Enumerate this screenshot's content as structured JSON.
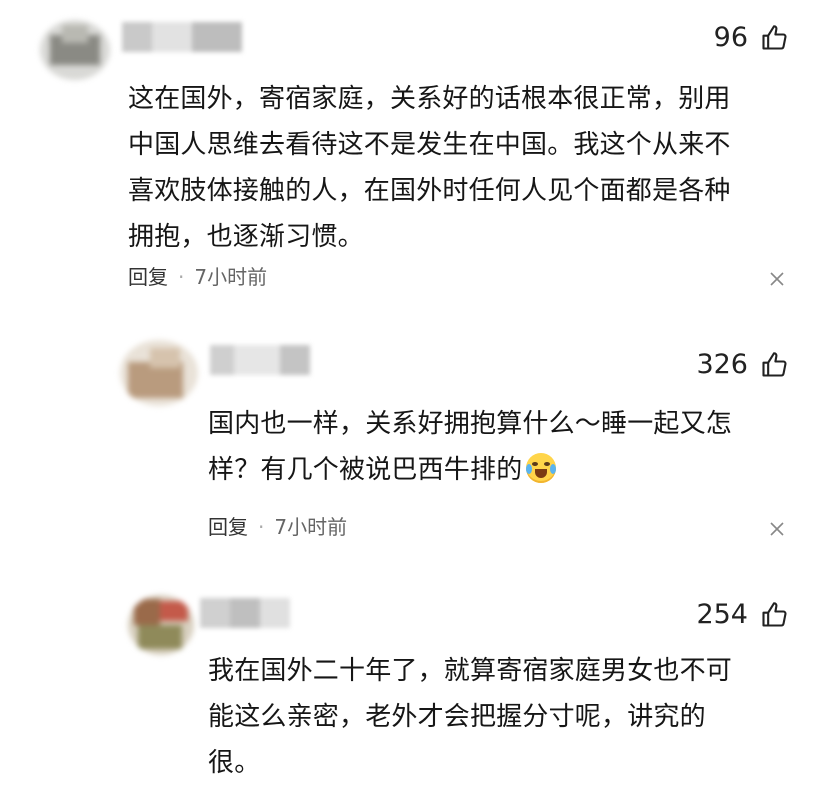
{
  "colors": {
    "background": "#ffffff",
    "text": "#161616",
    "meta": "#666666",
    "emoji": "#ffd54a"
  },
  "comments": [
    {
      "likes": "96",
      "text": "这在国外，寄宿家庭，关系好的话根本很正常，别用中国人思维去看待这不是发生在中国。我这个从来不喜欢肢体接触的人，在国外时任何人见个面都是各种拥抱，也逐渐习惯。",
      "lines": [
        "这在国外，寄宿家庭，关系好的话根本很正常，别用",
        "中国人思维去看待这不是发生在中国。我这个从来不",
        "喜欢肢体接触的人，在国外时任何人见个面都是各种",
        "拥抱，也逐渐习惯。"
      ],
      "reply_label": "回复",
      "time": "7小时前",
      "icons": [
        "thumbs-up-icon",
        "close-icon"
      ]
    },
    {
      "likes": "326",
      "lines": [
        "国内也一样，关系好拥抱算什么～睡一起又怎",
        "样？有几个被说巴西牛排的"
      ],
      "emoji": "crying-laughing-emoji",
      "reply_label": "回复",
      "time": "7小时前",
      "icons": [
        "thumbs-up-icon",
        "close-icon"
      ]
    },
    {
      "likes": "254",
      "lines": [
        "我在国外二十年了，就算寄宿家庭男女也不可",
        "能这么亲密，老外才会把握分寸呢，讲究的",
        "很。"
      ],
      "icons": [
        "thumbs-up-icon"
      ]
    }
  ]
}
